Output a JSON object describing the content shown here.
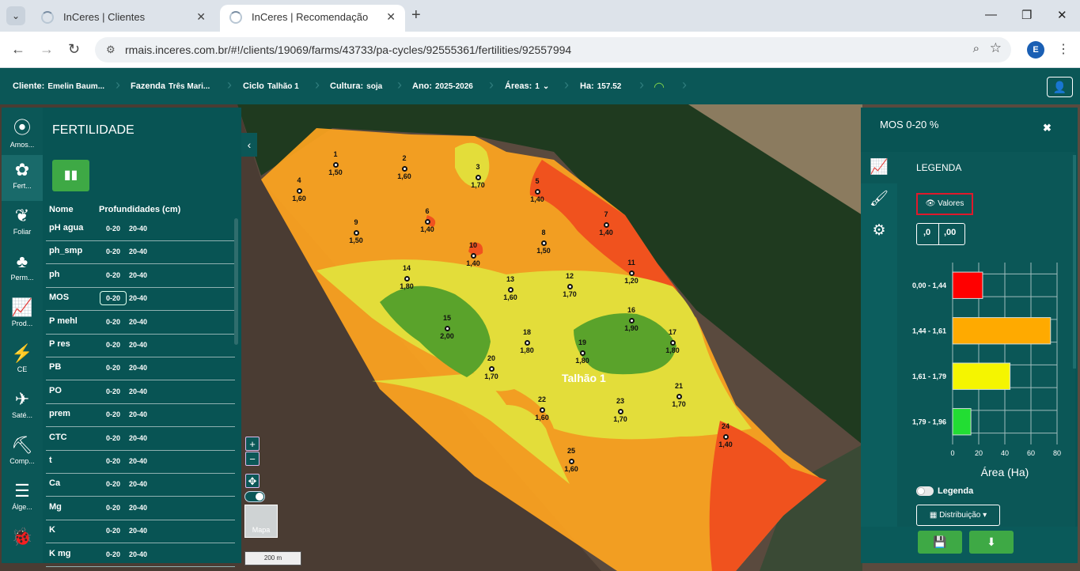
{
  "browser": {
    "tabs": [
      {
        "title": "InCeres | Clientes",
        "active": false
      },
      {
        "title": "InCeres | Recomendação",
        "active": true
      }
    ],
    "url": "rmais.inceres.com.br/#!/clients/19069/farms/43733/pa-cycles/92555361/fertilities/92557994",
    "profile_initial": "E"
  },
  "header": {
    "cliente_label": "Cliente:",
    "cliente_value": "Emelin Baum...",
    "fazenda_label": "Fazenda",
    "fazenda_value": "Três Mari...",
    "ciclo_label": "Ciclo",
    "ciclo_value": "Talhão 1",
    "cultura_label": "Cultura:",
    "cultura_value": "soja",
    "ano_label": "Ano:",
    "ano_value": "2025-2026",
    "areas_label": "Áreas:",
    "areas_value": "1",
    "ha_label": "Ha:",
    "ha_value": "157.52"
  },
  "rail": [
    {
      "label": "Amos...",
      "icon": "soil-sample-icon",
      "glyph": "⦿"
    },
    {
      "label": "Fert...",
      "icon": "fertility-icon",
      "glyph": "✿",
      "active": true
    },
    {
      "label": "Foliar",
      "icon": "leaf-icon",
      "glyph": "❦"
    },
    {
      "label": "Perm...",
      "icon": "plant-icon",
      "glyph": "♣"
    },
    {
      "label": "Prod...",
      "icon": "chart-line-icon",
      "glyph": "📈"
    },
    {
      "label": "CE",
      "icon": "ce-plant-icon",
      "glyph": "⚡"
    },
    {
      "label": "Saté...",
      "icon": "satellite-icon",
      "glyph": "✈"
    },
    {
      "label": "Comp...",
      "icon": "compaction-icon",
      "glyph": "⛏"
    },
    {
      "label": "Álge...",
      "icon": "layers-icon",
      "glyph": "☰"
    },
    {
      "label": "",
      "icon": "bug-icon",
      "glyph": "🐞"
    }
  ],
  "left_panel": {
    "title": "FERTILIDADE",
    "col_name": "Nome",
    "col_depths": "Profundidades (cm)",
    "rows": [
      {
        "name": "pH agua",
        "d1": "0-20",
        "d2": "20-40"
      },
      {
        "name": "ph_smp",
        "d1": "0-20",
        "d2": "20-40"
      },
      {
        "name": "ph",
        "d1": "0-20",
        "d2": "20-40"
      },
      {
        "name": "MOS",
        "d1": "0-20",
        "d2": "20-40",
        "selected": true
      },
      {
        "name": "P mehl",
        "d1": "0-20",
        "d2": "20-40"
      },
      {
        "name": "P res",
        "d1": "0-20",
        "d2": "20-40"
      },
      {
        "name": "PB",
        "d1": "0-20",
        "d2": "20-40"
      },
      {
        "name": "PO",
        "d1": "0-20",
        "d2": "20-40"
      },
      {
        "name": "prem",
        "d1": "0-20",
        "d2": "20-40"
      },
      {
        "name": "CTC",
        "d1": "0-20",
        "d2": "20-40"
      },
      {
        "name": "t",
        "d1": "0-20",
        "d2": "20-40"
      },
      {
        "name": "Ca",
        "d1": "0-20",
        "d2": "20-40"
      },
      {
        "name": "Mg",
        "d1": "0-20",
        "d2": "20-40"
      },
      {
        "name": "K",
        "d1": "0-20",
        "d2": "20-40"
      },
      {
        "name": "K mg",
        "d1": "0-20",
        "d2": "20-40"
      }
    ]
  },
  "map": {
    "field_label": "Talhão 1",
    "maps_button": "Mapa",
    "scale": "200 m",
    "points": [
      {
        "id": "1",
        "value": "1,50"
      },
      {
        "id": "2",
        "value": "1,60"
      },
      {
        "id": "3",
        "value": "1,70"
      },
      {
        "id": "4",
        "value": "1,60"
      },
      {
        "id": "5",
        "value": "1,40"
      },
      {
        "id": "6",
        "value": "1,40"
      },
      {
        "id": "7",
        "value": "1,40"
      },
      {
        "id": "8",
        "value": "1,50"
      },
      {
        "id": "9",
        "value": "1,50"
      },
      {
        "id": "10",
        "value": "1,40"
      },
      {
        "id": "11",
        "value": "1,20"
      },
      {
        "id": "12",
        "value": "1,70"
      },
      {
        "id": "13",
        "value": "1,60"
      },
      {
        "id": "14",
        "value": "1,80"
      },
      {
        "id": "15",
        "value": "2,00"
      },
      {
        "id": "16",
        "value": "1,90"
      },
      {
        "id": "17",
        "value": "1,80"
      },
      {
        "id": "18",
        "value": "1,80"
      },
      {
        "id": "19",
        "value": "1,80"
      },
      {
        "id": "20",
        "value": "1,70"
      },
      {
        "id": "21",
        "value": "1,70"
      },
      {
        "id": "22",
        "value": "1,60"
      },
      {
        "id": "23",
        "value": "1,70"
      },
      {
        "id": "24",
        "value": "1,40"
      },
      {
        "id": "25",
        "value": "1,60"
      }
    ]
  },
  "right_panel": {
    "title": "MOS 0-20 %",
    "legend_title": "LEGENDA",
    "values_button": "Valores",
    "dec_left": ",0",
    "dec_right": ",00",
    "legend_toggle_label": "Legenda",
    "distribution_button": "Distribuição",
    "colors": {
      "red": "#ff0000",
      "orange": "#ffaa00",
      "yellow": "#f5f500",
      "green": "#22dd33"
    }
  },
  "chart_data": {
    "type": "bar",
    "orientation": "horizontal",
    "categories": [
      "0,00 - 1,44",
      "1,44 - 1,61",
      "1,61 - 1,79",
      "1,79 - 1,96"
    ],
    "values": [
      23,
      75,
      44,
      14
    ],
    "colors": [
      "#ff0000",
      "#ffaa00",
      "#f5f500",
      "#22dd33"
    ],
    "xlabel": "Área (Ha)",
    "xlim": [
      0,
      80
    ],
    "xticks": [
      "0",
      "20",
      "40",
      "60",
      "80"
    ],
    "grid": true
  }
}
